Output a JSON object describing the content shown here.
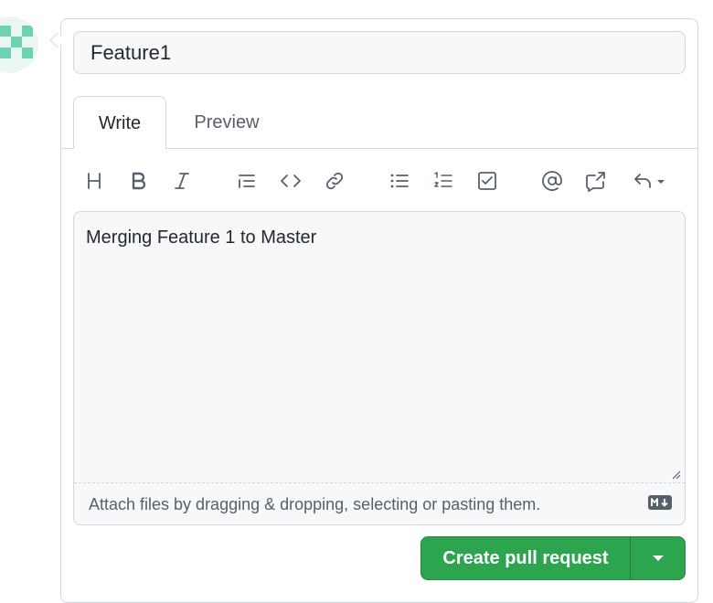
{
  "pull_request": {
    "title_value": "Feature1",
    "body_value": "Merging Feature 1 to Master"
  },
  "tabs": [
    {
      "label": "Write",
      "active": true
    },
    {
      "label": "Preview",
      "active": false
    }
  ],
  "toolbar": {
    "icons": [
      "heading-icon",
      "bold-icon",
      "italic-icon",
      "quote-icon",
      "code-icon",
      "link-icon",
      "unordered-list-icon",
      "ordered-list-icon",
      "task-list-icon",
      "mention-icon",
      "cross-reference-icon",
      "reply-icon"
    ]
  },
  "editor": {
    "attach_hint": "Attach files by dragging & dropping, selecting or pasting them.",
    "markdown_badge": "markdown-icon"
  },
  "actions": {
    "create_label": "Create pull request",
    "dropdown_icon": "triangle-down-icon"
  },
  "colors": {
    "primary_button": "#2da44e",
    "border": "#d0d7de",
    "input_bg": "#f6f8fa",
    "muted_text": "#57606a",
    "avatar_accent": "#6fd1b3"
  }
}
